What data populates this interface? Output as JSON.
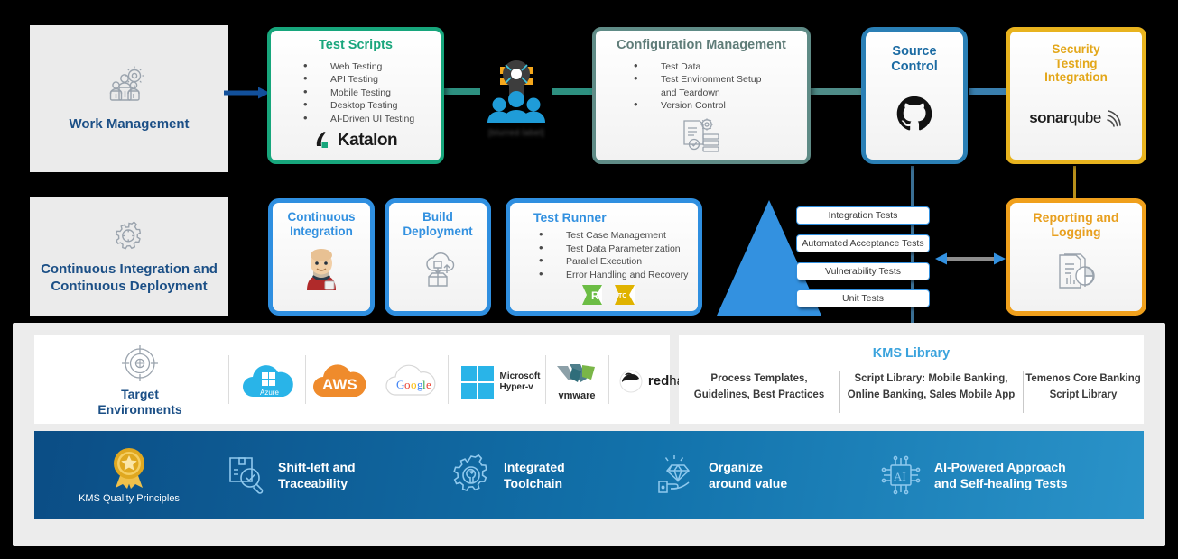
{
  "left_column": [
    {
      "id": "work-management",
      "label": "Work Management",
      "icon": "people-gear-icon"
    },
    {
      "id": "cicd",
      "label": "Continuous Integration and Continuous Deployment",
      "icon": "gear-outline-icon"
    }
  ],
  "row1": {
    "test_scripts": {
      "title": "Test Scripts",
      "title_color": "#1aa67c",
      "border_color": "#17a67c",
      "bullets": [
        "Web Testing",
        "API Testing",
        "Mobile Testing",
        "Desktop Testing",
        "AI-Driven UI Testing"
      ],
      "logo": "katalon-logo",
      "logo_text": "Katalon"
    },
    "middle_icon": {
      "icon": "people-collaboration-icon",
      "caption": "[blurred label]"
    },
    "configuration_management": {
      "title": "Configuration Management",
      "title_color": "#5f7c78",
      "border_color": "#5f8b86",
      "bullets": [
        "Test Data",
        "Test Environment Setup",
        "and Teardown",
        "Version Control"
      ],
      "icon": "document-gear-icon"
    },
    "source_control": {
      "title": "Source\nControl",
      "title_line1": "Source",
      "title_line2": "Control",
      "title_color": "#1b6ba3",
      "border_color": "#2a7fb5",
      "logo": "github-logo"
    },
    "security_testing": {
      "title_line1": "Security",
      "title_line2": "Testing",
      "title_line3": "Integration",
      "title_color": "#e3a71a",
      "border_color": "#e8b31e",
      "logo": "sonarqube-logo",
      "logo_text_bold": "sonar",
      "logo_text_light": "qube"
    }
  },
  "row2": {
    "continuous_integration": {
      "title_line1": "Continuous",
      "title_line2": "Integration",
      "title_color": "#3391e0",
      "border_color": "#2f8fe0",
      "logo": "jenkins-logo"
    },
    "build_deployment": {
      "title_line1": "Build",
      "title_line2": "Deployment",
      "title_color": "#3391e0",
      "border_color": "#2f8fe0",
      "icon": "cloud-deploy-icon"
    },
    "test_runner": {
      "title": "Test Runner",
      "title_color": "#3391e0",
      "border_color": "#2f8fe0",
      "bullets": [
        "Test Case Management",
        "Test Data Parameterization",
        "Parallel Execution",
        "Error Handling and Recovery"
      ],
      "logos": [
        "ranorex-logo",
        "testcomplete-logo"
      ]
    },
    "pyramid": {
      "labels": [
        "Integration Tests",
        "Automated Acceptance Tests",
        "Vulnerability Tests",
        "Unit Tests"
      ],
      "color": "#3391e0"
    },
    "reporting_logging": {
      "title_line1": "Reporting and",
      "title_line2": "Logging",
      "title_color": "#e8a020",
      "border_color": "#f0a01c",
      "icon": "report-chart-icon"
    }
  },
  "bottom": {
    "target_environments": {
      "label_line1": "Target",
      "label_line2": "Environments",
      "icon": "target-icon",
      "logos": [
        {
          "name": "azure-logo",
          "label": "Azure"
        },
        {
          "name": "aws-logo",
          "label": "AWS"
        },
        {
          "name": "google-cloud-logo",
          "label": "Google"
        },
        {
          "name": "microsoft-hyperv-logo",
          "label_line1": "Microsoft",
          "label_line2": "Hyper-v"
        },
        {
          "name": "vmware-logo",
          "label": "vmware"
        },
        {
          "name": "redhat-logo",
          "label_bold": "red",
          "label_light": "hat"
        }
      ]
    },
    "kms_library": {
      "title": "KMS Library",
      "columns": [
        {
          "line1": "Process Templates,",
          "line2": "Guidelines, Best Practices"
        },
        {
          "line1": "Script Library: Mobile Banking,",
          "line2": "Online Banking, Sales Mobile App"
        },
        {
          "line1": "Temenos Core Banking",
          "line2": "Script Library"
        }
      ]
    },
    "principles_bar": {
      "brand": {
        "label": "KMS Quality Principles",
        "icon": "award-ribbon-icon"
      },
      "items": [
        {
          "icon": "shift-left-traceability-icon",
          "line1": "Shift-left and",
          "line2": "Traceability"
        },
        {
          "icon": "integrated-toolchain-icon",
          "line1": "Integrated",
          "line2": "Toolchain"
        },
        {
          "icon": "organize-around-value-icon",
          "line1": "Organize",
          "line2": "around value"
        },
        {
          "icon": "ai-powered-icon",
          "line1": "AI-Powered Approach",
          "line2": "and Self-healing Tests"
        }
      ]
    }
  },
  "colors": {
    "dark_blue": "#1b4f86",
    "light_blue": "#3391e0",
    "green": "#17a67c",
    "yellow": "#e8b31e",
    "orange": "#f0a01c",
    "teal_grey": "#5f8b86",
    "arrow_blue": "#12509b"
  }
}
